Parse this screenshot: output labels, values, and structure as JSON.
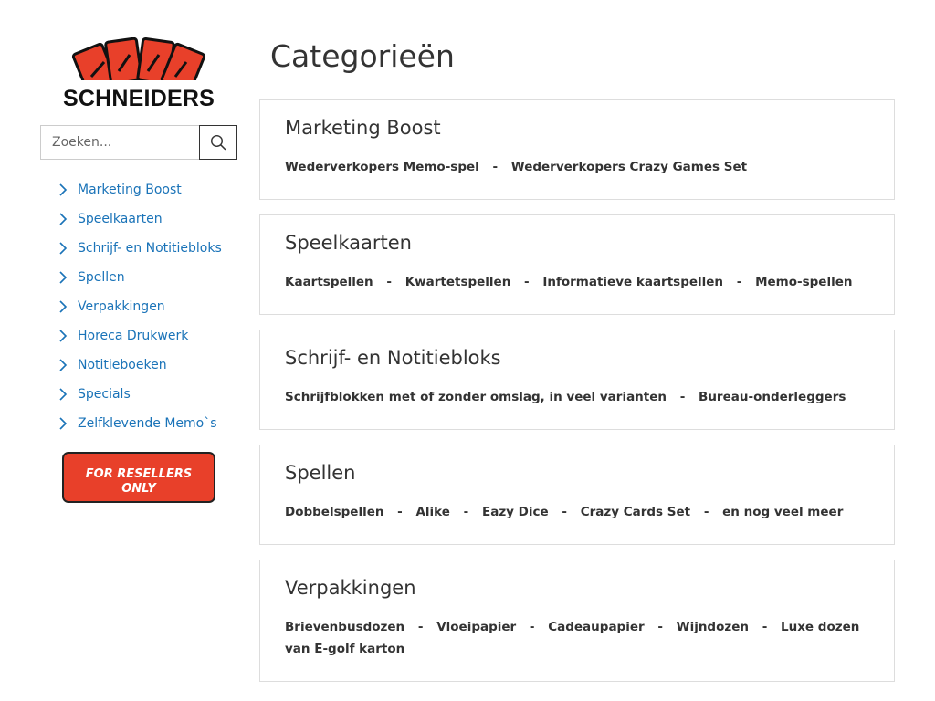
{
  "brand": {
    "name": "SCHNEIDERS",
    "accent_color": "#e8402a",
    "link_color": "#1a73b8"
  },
  "search": {
    "placeholder": "Zoeken...",
    "value": "",
    "icon": "search-icon"
  },
  "sidebar": {
    "items": [
      {
        "label": "Marketing Boost"
      },
      {
        "label": "Speelkaarten"
      },
      {
        "label": "Schrijf- en Notitiebloks"
      },
      {
        "label": "Spellen"
      },
      {
        "label": "Verpakkingen"
      },
      {
        "label": "Horeca Drukwerk"
      },
      {
        "label": "Notitieboeken"
      },
      {
        "label": "Specials"
      },
      {
        "label": "Zelfklevende Memo`s"
      }
    ],
    "reseller_button": {
      "line1": "FOR RESELLERS",
      "line2": "ONLY"
    }
  },
  "main": {
    "title": "Categorieën",
    "categories": [
      {
        "title": "Marketing Boost",
        "links": [
          "Wederverkopers Memo-spel",
          "Wederverkopers Crazy Games Set"
        ]
      },
      {
        "title": "Speelkaarten",
        "links": [
          "Kaartspellen",
          "Kwartetspellen",
          "Informatieve kaartspellen",
          "Memo-spellen"
        ]
      },
      {
        "title": "Schrijf- en Notitiebloks",
        "links": [
          "Schrijfblokken met of zonder omslag, in veel varianten",
          "Bureau-onderleggers"
        ]
      },
      {
        "title": "Spellen",
        "links": [
          "Dobbelspellen",
          "Alike",
          "Eazy Dice",
          "Crazy Cards Set",
          "en nog veel meer"
        ]
      },
      {
        "title": "Verpakkingen",
        "links": [
          "Brievenbusdozen",
          "Vloeipapier",
          "Cadeaupapier",
          "Wijndozen",
          "Luxe dozen van E-golf karton"
        ]
      }
    ],
    "separator": "-"
  }
}
